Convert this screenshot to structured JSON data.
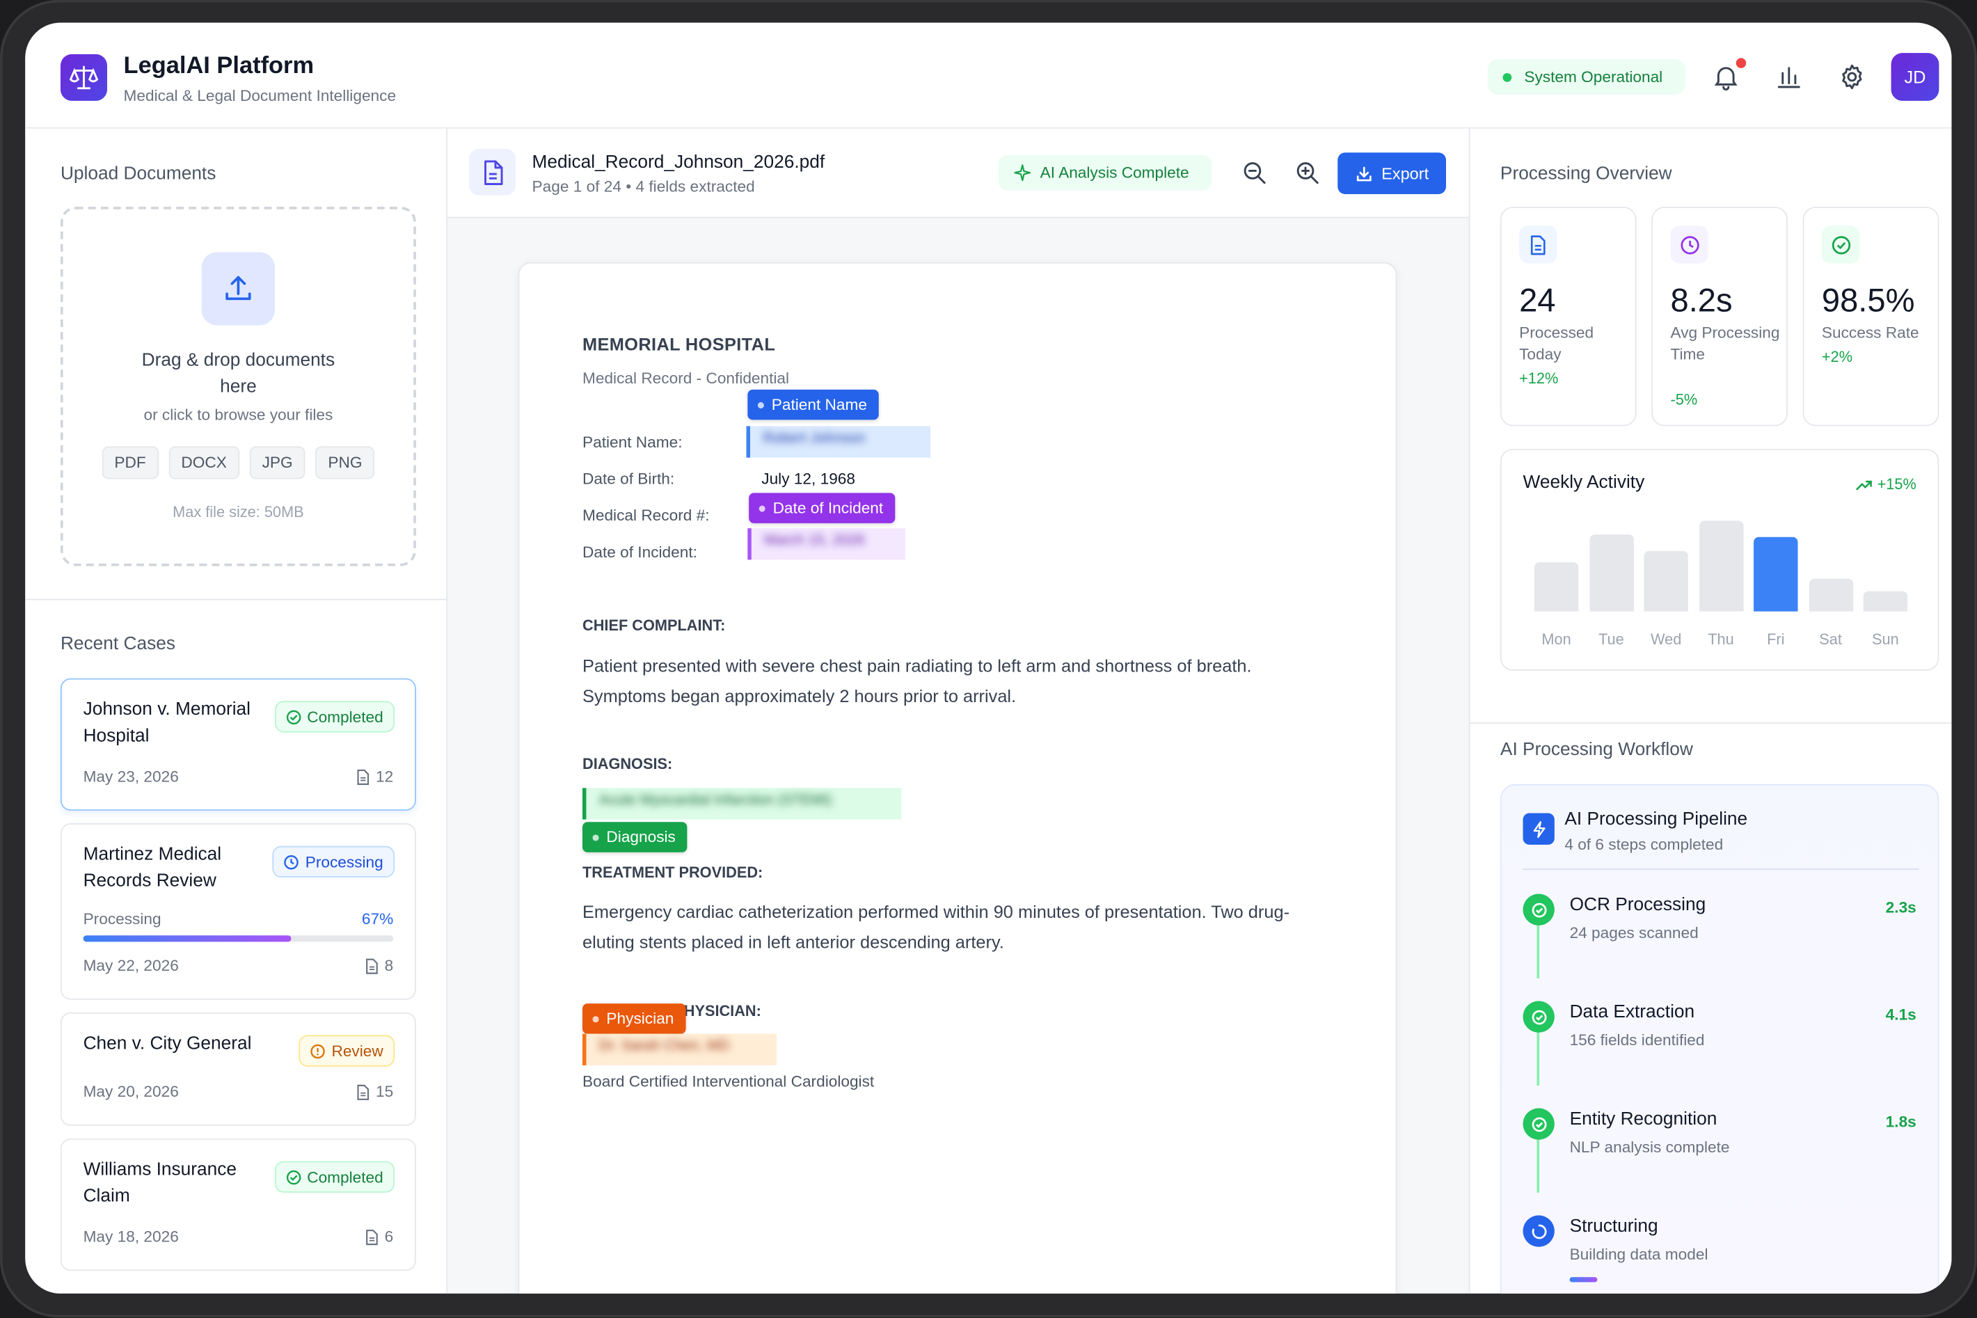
{
  "app": {
    "title": "LegalAI Platform",
    "subtitle": "Medical & Legal Document Intelligence",
    "status": "System Operational",
    "avatar_initials": "JD",
    "brand_color": "#5b21b6",
    "accent_color": "#2563eb"
  },
  "upload": {
    "section_title": "Upload Documents",
    "title": "Drag & drop documents here",
    "subtitle": "or click to browse your files",
    "formats": [
      "PDF",
      "DOCX",
      "JPG",
      "PNG"
    ],
    "max_size": "Max file size: 50MB",
    "icon": "upload-icon"
  },
  "recent": {
    "section_title": "Recent Cases",
    "cases": [
      {
        "title": "Johnson v. Memorial Hospital",
        "status": "Completed",
        "date": "May 23, 2026",
        "count": "12"
      },
      {
        "title": "Martinez Medical Records Review",
        "status": "Processing",
        "progress_label": "Processing",
        "progress_pct": "67%",
        "progress": 0.67,
        "date": "May 22, 2026",
        "count": "8"
      },
      {
        "title": "Chen v. City General",
        "status": "Review",
        "date": "May 20, 2026",
        "count": "15"
      },
      {
        "title": "Williams Insurance Claim",
        "status": "Completed",
        "date": "May 18, 2026",
        "count": "6"
      }
    ]
  },
  "document": {
    "filename": "Medical_Record_Johnson_2026.pdf",
    "meta": "Page 1 of 24 • 4 fields extracted",
    "ai_status": "AI Analysis Complete",
    "export_label": "Export",
    "hospital": "MEMORIAL HOSPITAL",
    "record_type": "Medical Record - Confidential",
    "fields": {
      "patient_name_label": "Patient Name:",
      "dob_label": "Date of Birth:",
      "dob_value": "July 12, 1968",
      "mrn_label": "Medical Record #:",
      "incident_label": "Date of Incident:"
    },
    "redacted": {
      "patient_name": "Robert Johnson",
      "incident_date": "March 15, 2026",
      "diagnosis": "Acute Myocardial Infarction (STEMI)",
      "physician": "Dr. Sarah Chen, MD"
    },
    "tags": {
      "patient": "Patient Name",
      "incident": "Date of Incident",
      "diagnosis": "Diagnosis",
      "physician": "Physician"
    },
    "chief_complaint_heading": "CHIEF COMPLAINT:",
    "chief_complaint": "Patient presented with severe chest pain radiating to left arm and shortness of breath. Symptoms began approximately 2 hours prior to arrival.",
    "diagnosis_heading": "DIAGNOSIS:",
    "treatment_heading": "TREATMENT PROVIDED:",
    "treatment": "Emergency cardiac catheterization performed within 90 minutes of presentation. Two drug-eluting stents placed in left anterior descending artery.",
    "physician_heading": "ATTENDING PHYSICIAN:",
    "physician_credential": "Board Certified Interventional Cardiologist"
  },
  "overview": {
    "section_title": "Processing Overview",
    "stats": [
      {
        "value": "24",
        "label": "Processed Today",
        "change": "+12%",
        "icon": "document-icon"
      },
      {
        "value": "8.2s",
        "label": "Avg Processing Time",
        "change": "-5%",
        "icon": "clock-icon"
      },
      {
        "value": "98.5%",
        "label": "Success Rate",
        "change": "+2%",
        "icon": "check-circle-icon"
      }
    ]
  },
  "weekly": {
    "title": "Weekly Activity",
    "change": "+15%"
  },
  "chart_data": {
    "type": "bar",
    "categories": [
      "Mon",
      "Tue",
      "Wed",
      "Thu",
      "Fri",
      "Sat",
      "Sun"
    ],
    "values": [
      36,
      57,
      45,
      67,
      55,
      24,
      15
    ],
    "highlight": "Fri",
    "title": "Weekly Activity"
  },
  "workflow": {
    "section_title": "AI Processing Workflow",
    "title": "AI Processing Pipeline",
    "subtitle": "4 of 6 steps completed",
    "steps": [
      {
        "name": "OCR Processing",
        "detail": "24 pages scanned",
        "time": "2.3s",
        "state": "done"
      },
      {
        "name": "Data Extraction",
        "detail": "156 fields identified",
        "time": "4.1s",
        "state": "done"
      },
      {
        "name": "Entity Recognition",
        "detail": "NLP analysis complete",
        "time": "1.8s",
        "state": "done"
      },
      {
        "name": "Structuring",
        "detail": "Building data model",
        "time": "",
        "state": "active"
      }
    ]
  }
}
